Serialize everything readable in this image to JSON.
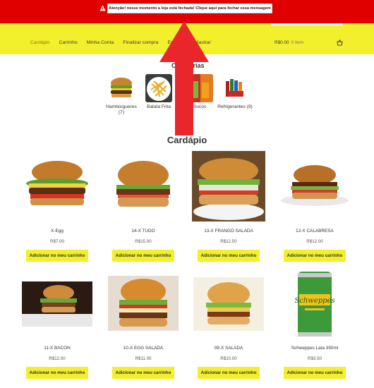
{
  "notice": {
    "text": "Atenção! nesse momento a loja está fechada! Clique aqui para fechar essa mensagem",
    "icon": "warning-icon"
  },
  "nav": {
    "items": [
      "Cardápio",
      "Carrinho",
      "Minha Conta",
      "Finalizar compra",
      "Entrar",
      "Cadastrar"
    ]
  },
  "cart": {
    "total": "R$0.00",
    "count": "0 item",
    "icon": "basket-icon"
  },
  "categories": {
    "title": "Categorias",
    "items": [
      {
        "label": "Hambúrgueres (7)"
      },
      {
        "label": "Batata Frita"
      },
      {
        "label": "Sucos"
      },
      {
        "label": "Refrigerantes (9)"
      }
    ]
  },
  "menu": {
    "title": "Cardápio",
    "button_label": "Adicionar no meu carrinho",
    "products": [
      {
        "name": "X-Egg",
        "price": "R$7.00"
      },
      {
        "name": "14-X TUDO",
        "price": "R$15.00"
      },
      {
        "name": "13-X FRANGO SALADA",
        "price": "R$12.50"
      },
      {
        "name": "12-X CALABRESA",
        "price": "R$12.00"
      },
      {
        "name": "11-X BACON",
        "price": "R$12.00"
      },
      {
        "name": "10-X EGG SALADA",
        "price": "R$11.00"
      },
      {
        "name": "09-X SALADA",
        "price": "R$10.00"
      },
      {
        "name": "Schweppes Lata 350ml",
        "price": "R$3.50"
      }
    ]
  },
  "colors": {
    "notice_bg": "#e10000",
    "header_bg": "#f2ef2c",
    "button_bg": "#f2ef2c",
    "arrow": "#e8262b"
  }
}
